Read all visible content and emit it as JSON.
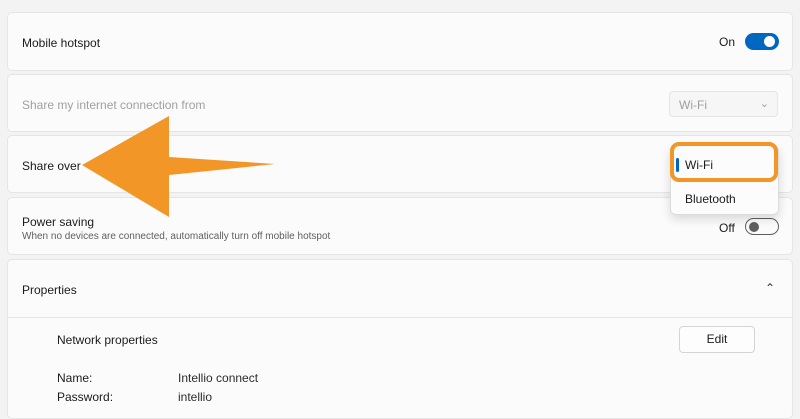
{
  "mobile_hotspot": {
    "label": "Mobile hotspot",
    "state_text": "On",
    "enabled": true
  },
  "share_from": {
    "label": "Share my internet connection from",
    "value": "Wi-Fi"
  },
  "share_over": {
    "label": "Share over",
    "options": [
      {
        "label": "Wi-Fi",
        "selected": true
      },
      {
        "label": "Bluetooth",
        "selected": false
      }
    ]
  },
  "power_saving": {
    "label": "Power saving",
    "description": "When no devices are connected, automatically turn off mobile hotspot",
    "state_text": "Off",
    "enabled": false
  },
  "properties": {
    "title": "Properties",
    "network_properties_label": "Network properties",
    "edit_label": "Edit",
    "rows": [
      {
        "key": "Name:",
        "value": "Intellio connect"
      },
      {
        "key": "Password:",
        "value": "intellio"
      }
    ]
  },
  "colors": {
    "accent": "#0067c0",
    "highlight": "#f19627"
  }
}
